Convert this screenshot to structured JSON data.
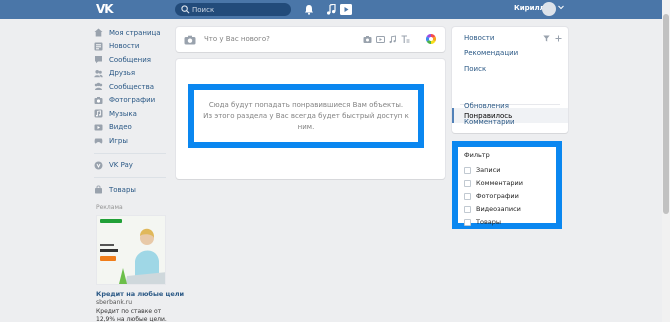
{
  "topbar": {
    "logo": "VK",
    "search_placeholder": "Поиск",
    "user_name": "Кирилл"
  },
  "nav": {
    "items": [
      {
        "label": "Моя страница",
        "icon": "home-icon"
      },
      {
        "label": "Новости",
        "icon": "news-icon"
      },
      {
        "label": "Сообщения",
        "icon": "messages-icon"
      },
      {
        "label": "Друзья",
        "icon": "friends-icon"
      },
      {
        "label": "Сообщества",
        "icon": "communities-icon"
      },
      {
        "label": "Фотографии",
        "icon": "photos-icon"
      },
      {
        "label": "Музыка",
        "icon": "music-icon"
      },
      {
        "label": "Видео",
        "icon": "video-icon"
      },
      {
        "label": "Игры",
        "icon": "games-icon"
      }
    ],
    "vkpay": "VK Pay",
    "goods": "Товары"
  },
  "ads": {
    "label": "Реклама",
    "title": "Кредит на любые цели",
    "domain": "sberbank.ru",
    "text": "Кредит по ставке от 12,9% на любые цели."
  },
  "post": {
    "placeholder": "Что у Вас нового?"
  },
  "feed": {
    "empty_line1": "Сюда будут попадать понравившиеся Вам объекты.",
    "empty_line2": "Из этого раздела у Вас всегда будет быстрый доступ к ним."
  },
  "right_menu": {
    "news": "Новости",
    "recommendations": "Рекомендации",
    "search": "Поиск",
    "liked": "Понравилось",
    "updates": "Обновления",
    "comments": "Комментарии"
  },
  "filter": {
    "title": "Фильтр",
    "options": [
      "Записи",
      "Комментарии",
      "Фотографии",
      "Видеозаписи",
      "Товары"
    ]
  },
  "colors": {
    "header": "#4a76a8",
    "accent_highlight": "#0a87f0",
    "link": "#2a5885"
  }
}
